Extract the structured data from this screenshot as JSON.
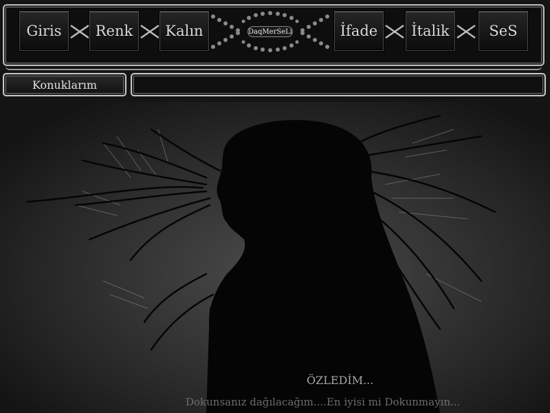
{
  "menu": {
    "items": [
      {
        "label": "Giris"
      },
      {
        "label": "Renk"
      },
      {
        "label": "Kalın"
      },
      {
        "label": "İfade"
      },
      {
        "label": "İtalik"
      },
      {
        "label": "SeS"
      }
    ],
    "logo_text": "DaqMerSeLi"
  },
  "subnav": {
    "tab_label": "Konuklarım"
  },
  "caption": {
    "title": "ÖZLEDİM...",
    "line": "Dokunsanız dağılacağım....En iyisi  mi Dokunmayın..."
  }
}
